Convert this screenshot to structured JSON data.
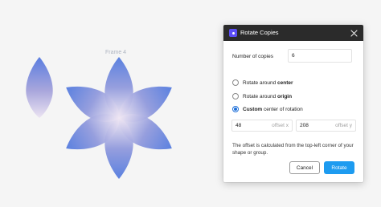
{
  "canvas": {
    "frame_label": "Frame 4"
  },
  "dialog": {
    "title": "Rotate Copies",
    "copies_label": "Number of copies",
    "copies_value": "6",
    "options": [
      {
        "prefix": "Rotate around ",
        "bold": "center",
        "suffix": "",
        "checked": false
      },
      {
        "prefix": "Rotate around ",
        "bold": "origin",
        "suffix": "",
        "checked": false
      },
      {
        "prefix": "",
        "bold": "Custom",
        "suffix": " center of rotation",
        "checked": true
      }
    ],
    "offset_x": {
      "value": "48",
      "suffix": "offset x"
    },
    "offset_y": {
      "value": "208",
      "suffix": "offset y"
    },
    "help_text": "The offset is calculated from the top-left corner of your shape or group.",
    "cancel_label": "Cancel",
    "rotate_label": "Rotate"
  },
  "colors": {
    "accent": "#1d9bf0",
    "header_bg": "#2b2b2b",
    "app_icon": "#5b4df5",
    "petal_outer": "#5a7de0",
    "petal_inner": "#ece4f2"
  },
  "icons": {
    "app": "app-logo-icon",
    "close": "close-icon"
  }
}
